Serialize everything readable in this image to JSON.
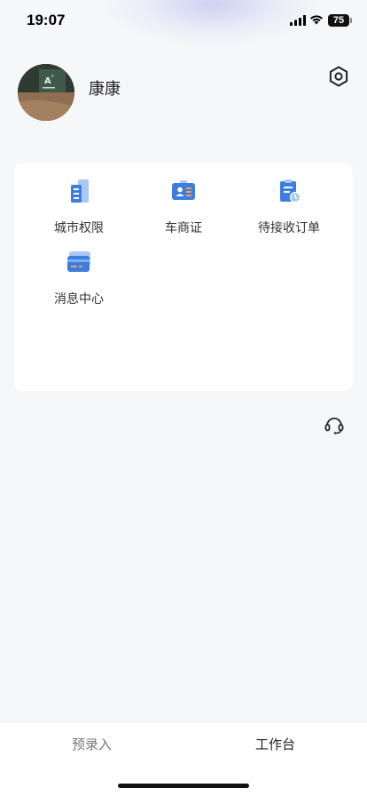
{
  "status_bar": {
    "time": "19:07",
    "battery": "75"
  },
  "profile": {
    "name": "康康",
    "avatar_badge": "A"
  },
  "menu": {
    "items": [
      {
        "label": "城市权限",
        "icon": "city-buildings-icon"
      },
      {
        "label": "车商证",
        "icon": "id-card-icon"
      },
      {
        "label": "待接收订单",
        "icon": "clipboard-clock-icon"
      },
      {
        "label": "消息中心",
        "icon": "card-message-icon"
      }
    ]
  },
  "tabs": {
    "left": "预录入",
    "right": "工作台"
  },
  "colors": {
    "accent": "#3b7de0",
    "accent_light": "#a9c8f3",
    "orange": "#f4a24a",
    "background": "#f6f7f9"
  }
}
